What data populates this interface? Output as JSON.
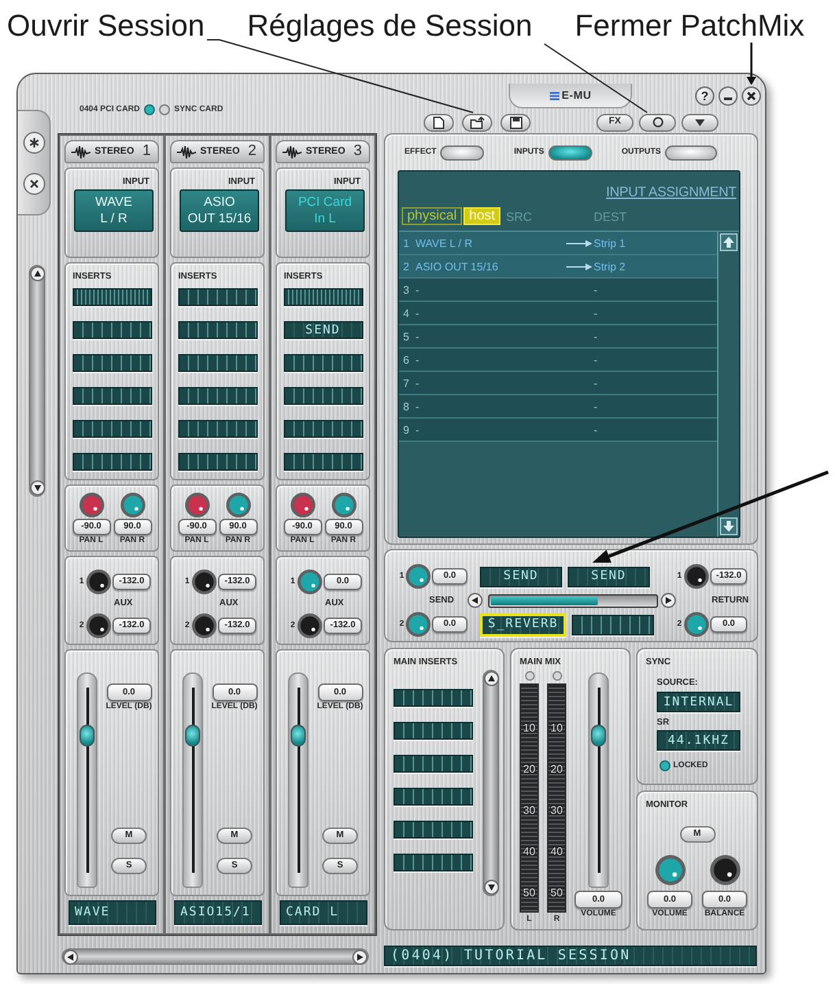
{
  "annotations": [
    {
      "text": "Ouvrir Session"
    },
    {
      "text": "Réglages de Session"
    },
    {
      "text": "Fermer PatchMix"
    }
  ],
  "indicators": [
    {
      "label": "0404 PCI CARD",
      "on": true
    },
    {
      "label": "SYNC CARD",
      "on": false
    }
  ],
  "logo": "E-MU",
  "window_controls": [
    {
      "kind": "help",
      "label": "?"
    },
    {
      "kind": "minimize"
    },
    {
      "kind": "close"
    }
  ],
  "file_buttons": [
    {
      "kind": "new"
    },
    {
      "kind": "open"
    },
    {
      "kind": "save"
    }
  ],
  "session_buttons": [
    {
      "kind": "text",
      "label": "FX"
    },
    {
      "kind": "settings"
    },
    {
      "kind": "menu"
    }
  ],
  "side_buttons": [
    {
      "kind": "asterisk"
    },
    {
      "kind": "cross"
    }
  ],
  "strips": [
    {
      "type": "STEREO",
      "number": "1",
      "input_label": "INPUT",
      "input": {
        "kind": "host",
        "lines": [
          "WAVE",
          "L / R"
        ]
      },
      "inserts_label": "INSERTS",
      "inserts": [
        {
          "kind": "hatched",
          "empty": true
        },
        {
          "kind": "plain",
          "empty": true
        },
        {
          "kind": "plain",
          "empty": true
        },
        {
          "kind": "plain",
          "empty": true
        },
        {
          "kind": "plain",
          "empty": true
        },
        {
          "kind": "plain",
          "empty": true
        }
      ],
      "pan": [
        {
          "value": "-90.0",
          "label": "PAN L",
          "color": "#c8324e"
        },
        {
          "value": "90.0",
          "label": "PAN R",
          "color": "#1fa6a8"
        }
      ],
      "aux_label": "AUX",
      "aux": [
        {
          "number": "1",
          "value": "-132.0",
          "color": "#1c1c1c"
        },
        {
          "number": "2",
          "value": "-132.0",
          "color": "#1c1c1c"
        }
      ],
      "fader": {
        "value": "0.0",
        "label": "LEVEL (DB)",
        "level": 0.74
      },
      "mute": "M",
      "solo": "S",
      "name": "WAVE"
    },
    {
      "type": "STEREO",
      "number": "2",
      "input_label": "INPUT",
      "input": {
        "kind": "host",
        "lines": [
          "ASIO",
          "OUT 15/16"
        ]
      },
      "inserts_label": "INSERTS",
      "inserts": [
        {
          "kind": "plain",
          "empty": true
        },
        {
          "kind": "plain",
          "empty": true
        },
        {
          "kind": "plain",
          "empty": true
        },
        {
          "kind": "plain",
          "empty": true
        },
        {
          "kind": "plain",
          "empty": true
        },
        {
          "kind": "plain",
          "empty": true
        }
      ],
      "pan": [
        {
          "value": "-90.0",
          "label": "PAN L",
          "color": "#c8324e"
        },
        {
          "value": "90.0",
          "label": "PAN R",
          "color": "#1fa6a8"
        }
      ],
      "aux_label": "AUX",
      "aux": [
        {
          "number": "1",
          "value": "-132.0",
          "color": "#1c1c1c"
        },
        {
          "number": "2",
          "value": "-132.0",
          "color": "#1c1c1c"
        }
      ],
      "fader": {
        "value": "0.0",
        "label": "LEVEL (DB)",
        "level": 0.74
      },
      "mute": "M",
      "solo": "S",
      "name": "ASIO15/1"
    },
    {
      "type": "STEREO",
      "number": "3",
      "input_label": "INPUT",
      "input": {
        "kind": "physical",
        "lines": [
          "PCI Card",
          "In L"
        ]
      },
      "inserts_label": "INSERTS",
      "inserts": [
        {
          "kind": "hatched",
          "empty": true
        },
        {
          "kind": "plain",
          "empty": false,
          "text": "SEND"
        },
        {
          "kind": "plain",
          "empty": true
        },
        {
          "kind": "plain",
          "empty": true
        },
        {
          "kind": "plain",
          "empty": true
        },
        {
          "kind": "plain",
          "empty": true
        }
      ],
      "pan": [
        {
          "value": "-90.0",
          "label": "PAN L",
          "color": "#c8324e"
        },
        {
          "value": "90.0",
          "label": "PAN R",
          "color": "#1fa6a8"
        }
      ],
      "aux_label": "AUX",
      "aux": [
        {
          "number": "1",
          "value": "0.0",
          "color": "#1fa6a8"
        },
        {
          "number": "2",
          "value": "-132.0",
          "color": "#1c1c1c"
        }
      ],
      "fader": {
        "value": "0.0",
        "label": "LEVEL (DB)",
        "level": 0.74
      },
      "mute": "M",
      "solo": "S",
      "name": "CARD L"
    }
  ],
  "tabs": [
    {
      "label": "EFFECT",
      "selected": false
    },
    {
      "label": "INPUTS",
      "selected": true
    },
    {
      "label": "OUTPUTS",
      "selected": false
    }
  ],
  "assignment": {
    "title": "INPUT ASSIGNMENT",
    "modes": [
      {
        "label": "physical",
        "selected": false
      },
      {
        "label": "host",
        "selected": true
      }
    ],
    "src": "SRC",
    "dest": "DEST",
    "rows": [
      {
        "number": "1",
        "source": "WAVE L / R",
        "dest": "Strip 1",
        "routed": true
      },
      {
        "number": "2",
        "source": "ASIO OUT 15/16",
        "dest": "Strip 2",
        "routed": true
      },
      {
        "number": "3",
        "source": "-",
        "dest": "-",
        "routed": false
      },
      {
        "number": "4",
        "source": "-",
        "dest": "-",
        "routed": false
      },
      {
        "number": "5",
        "source": "-",
        "dest": "-",
        "routed": false
      },
      {
        "number": "6",
        "source": "-",
        "dest": "-",
        "routed": false
      },
      {
        "number": "7",
        "source": "-",
        "dest": "-",
        "routed": false
      },
      {
        "number": "8",
        "source": "-",
        "dest": "-",
        "routed": false
      },
      {
        "number": "9",
        "source": "-",
        "dest": "-",
        "routed": false
      }
    ]
  },
  "send": {
    "knobs": [
      {
        "number": "1",
        "value": "0.0",
        "color": "#1fa6a8"
      },
      {
        "number": "2",
        "value": "0.0",
        "color": "#1fa6a8"
      }
    ],
    "label": "SEND",
    "slots": [
      {
        "empty": false,
        "text": "SEND",
        "selected": false
      },
      {
        "empty": false,
        "text": "SEND",
        "selected": false
      },
      {
        "empty": false,
        "text": "S_REVERB",
        "selected": true
      },
      {
        "empty": true,
        "selected": false
      }
    ],
    "slider": {
      "level": 0.65
    },
    "return_label": "RETURN",
    "returns": [
      {
        "number": "1",
        "value": "-132.0",
        "color": "#1c1c1c"
      },
      {
        "number": "2",
        "value": "0.0",
        "color": "#1fa6a8"
      }
    ]
  },
  "main_inserts": {
    "title": "MAIN INSERTS",
    "slots": [
      {
        "empty": true
      },
      {
        "empty": true
      },
      {
        "empty": true
      },
      {
        "empty": true
      },
      {
        "empty": true
      },
      {
        "empty": true
      }
    ]
  },
  "main_mix": {
    "title": "MAIN MIX",
    "meters": [
      {
        "label": "L",
        "scale": [
          "10",
          "20",
          "30",
          "40",
          "50"
        ]
      },
      {
        "label": "R",
        "scale": [
          "10",
          "20",
          "30",
          "40",
          "50"
        ]
      }
    ],
    "fader": {
      "value": "0.0",
      "label": "VOLUME",
      "level": 0.74
    }
  },
  "sync": {
    "title": "SYNC",
    "source_label": "SOURCE:",
    "source": "INTERNAL",
    "rate_label": "SR",
    "rate": "44.1KHZ",
    "locked": {
      "label": "LOCKED",
      "on": true
    }
  },
  "monitor": {
    "title": "MONITOR",
    "mute": "M",
    "knobs": [
      {
        "value": "0.0",
        "label": "VOLUME",
        "color": "#1fa6a8"
      },
      {
        "value": "0.0",
        "label": "BALANCE",
        "color": "#1c1c1c"
      }
    ]
  },
  "session_name": "(0404) TUTORIAL SESSION"
}
